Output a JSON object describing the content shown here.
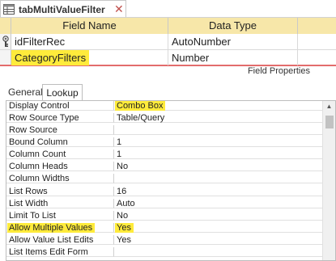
{
  "document_tab": {
    "title": "tabMultiValueFilter",
    "close_glyph": "✕"
  },
  "grid": {
    "headers": {
      "field_name": "Field Name",
      "data_type": "Data Type",
      "description": ""
    },
    "rows": [
      {
        "field_name": "idFilterRec",
        "data_type": "AutoNumber",
        "primary_key": true
      },
      {
        "field_name": "CategoryFilters",
        "data_type": "Number",
        "highlighted": true
      }
    ]
  },
  "field_properties_label": "Field Properties",
  "property_tabs": [
    {
      "label": "General",
      "selected": false
    },
    {
      "label": "Lookup",
      "selected": true
    }
  ],
  "properties": [
    {
      "label": "Display Control",
      "value": "Combo Box",
      "highlight_label": false,
      "highlight_value": true
    },
    {
      "label": "Row Source Type",
      "value": "Table/Query"
    },
    {
      "label": "Row Source",
      "value": ""
    },
    {
      "label": "Bound Column",
      "value": "1"
    },
    {
      "label": "Column Count",
      "value": "1"
    },
    {
      "label": "Column Heads",
      "value": "No"
    },
    {
      "label": "Column Widths",
      "value": ""
    },
    {
      "label": "List Rows",
      "value": "16"
    },
    {
      "label": "List Width",
      "value": "Auto"
    },
    {
      "label": "Limit To List",
      "value": "No"
    },
    {
      "label": "Allow Multiple Values",
      "value": "Yes",
      "highlight_label": true,
      "highlight_value": true
    },
    {
      "label": "Allow Value List Edits",
      "value": "Yes"
    },
    {
      "label": "List Items Edit Form",
      "value": ""
    }
  ],
  "colors": {
    "header_bg": "#f7e7a9",
    "highlight": "#ffeb3b",
    "selected_row_border": "#e36c6c"
  },
  "icons": {
    "table": "table-icon",
    "key": "primary-key-icon",
    "close": "close-icon",
    "scroll_up": "scroll-up-arrow-icon"
  }
}
